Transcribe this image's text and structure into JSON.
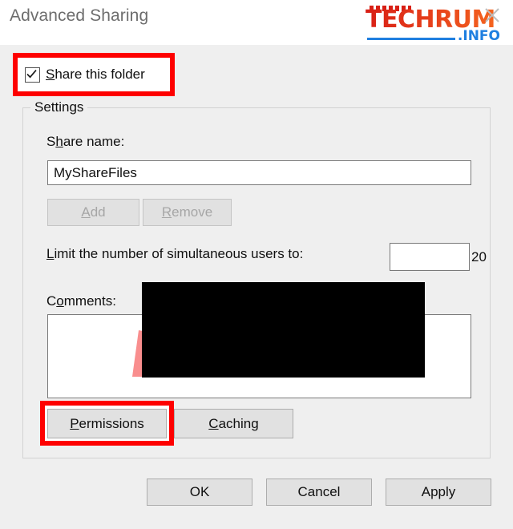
{
  "window": {
    "title": "Advanced Sharing",
    "close_icon": "close-x-icon"
  },
  "watermark": {
    "brand": "TECHRUM",
    "suffix": ".INFO",
    "brand_color": "#e02b1a",
    "suffix_color": "#1f7fe0"
  },
  "share_checkbox": {
    "label_prefix": "S",
    "label_rest": "hare this folder",
    "checked": true,
    "check_icon": "checkmark-icon",
    "highlight_color": "#fe0000"
  },
  "settings": {
    "legend": "Settings",
    "share_name": {
      "label_pre": "S",
      "label_acc": "h",
      "label_post": "are name:",
      "value": "MyShareFiles"
    },
    "add_button": {
      "label_acc": "A",
      "label_post": "dd",
      "enabled": false
    },
    "remove_button": {
      "label_acc": "R",
      "label_post": "emove",
      "enabled": false
    },
    "limit_users": {
      "label_acc": "L",
      "label_post": "imit the number of simultaneous users to:",
      "value": "20",
      "increment_icon": "spinner-up-icon",
      "decrement_icon": "spinner-down-icon"
    },
    "comments": {
      "label_pre": "C",
      "label_acc": "o",
      "label_post": "mments:",
      "value": ""
    },
    "permissions_button": {
      "label_acc": "P",
      "label_post": "ermissions",
      "highlight_color": "#fe0000"
    },
    "caching_button": {
      "label_acc": "C",
      "label_post": "aching"
    }
  },
  "footer": {
    "ok_label": "OK",
    "cancel_label": "Cancel",
    "apply_label": "Apply"
  },
  "annotations": {
    "redaction_box_color": "#000000",
    "arrow_color": "#f98e8e"
  }
}
